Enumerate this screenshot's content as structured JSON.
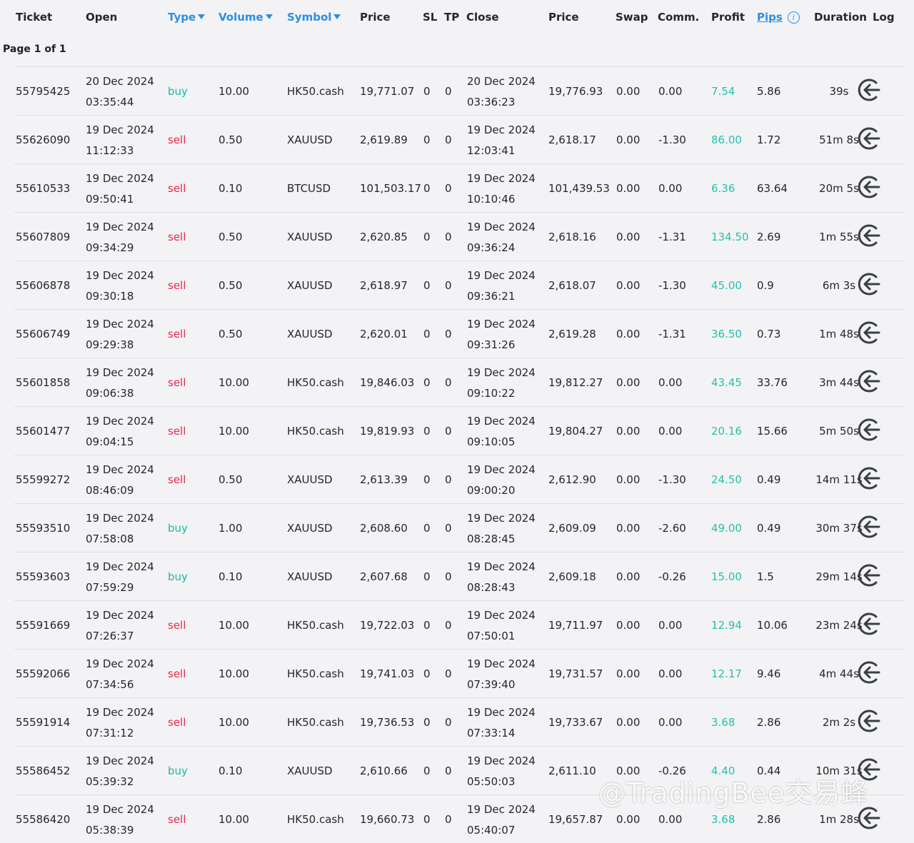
{
  "header": {
    "ticket": "Ticket",
    "open": "Open",
    "type": "Type",
    "volume": "Volume",
    "symbol": "Symbol",
    "price": "Price",
    "sl": "SL",
    "tp": "TP",
    "close": "Close",
    "close_price": "Price",
    "swap": "Swap",
    "comm": "Comm.",
    "profit": "Profit",
    "pips": "Pips",
    "info": "i",
    "duration": "Duration",
    "log": "Log"
  },
  "page_info": "Page 1 of 1",
  "colors": {
    "buy": "#1bb8a8",
    "sell": "#e8274b",
    "profit": "#25c1ad",
    "link": "#2d8ee3"
  },
  "rows": [
    {
      "ticket": "55795425",
      "open_date": "20 Dec 2024",
      "open_time": "03:35:44",
      "type": "buy",
      "volume": "10.00",
      "symbol": "HK50.cash",
      "price": "19,771.07",
      "sl": "0",
      "tp": "0",
      "close_date": "20 Dec 2024",
      "close_time": "03:36:23",
      "close_price": "19,776.93",
      "swap": "0.00",
      "comm": "0.00",
      "profit": "7.54",
      "pips": "5.86",
      "duration": "39s"
    },
    {
      "ticket": "55626090",
      "open_date": "19 Dec 2024",
      "open_time": "11:12:33",
      "type": "sell",
      "volume": "0.50",
      "symbol": "XAUUSD",
      "price": "2,619.89",
      "sl": "0",
      "tp": "0",
      "close_date": "19 Dec 2024",
      "close_time": "12:03:41",
      "close_price": "2,618.17",
      "swap": "0.00",
      "comm": "-1.30",
      "profit": "86.00",
      "pips": "1.72",
      "duration": "51m 8s"
    },
    {
      "ticket": "55610533",
      "open_date": "19 Dec 2024",
      "open_time": "09:50:41",
      "type": "sell",
      "volume": "0.10",
      "symbol": "BTCUSD",
      "price": "101,503.17",
      "sl": "0",
      "tp": "0",
      "close_date": "19 Dec 2024",
      "close_time": "10:10:46",
      "close_price": "101,439.53",
      "swap": "0.00",
      "comm": "0.00",
      "profit": "6.36",
      "pips": "63.64",
      "duration": "20m 5s"
    },
    {
      "ticket": "55607809",
      "open_date": "19 Dec 2024",
      "open_time": "09:34:29",
      "type": "sell",
      "volume": "0.50",
      "symbol": "XAUUSD",
      "price": "2,620.85",
      "sl": "0",
      "tp": "0",
      "close_date": "19 Dec 2024",
      "close_time": "09:36:24",
      "close_price": "2,618.16",
      "swap": "0.00",
      "comm": "-1.31",
      "profit": "134.50",
      "pips": "2.69",
      "duration": "1m 55s"
    },
    {
      "ticket": "55606878",
      "open_date": "19 Dec 2024",
      "open_time": "09:30:18",
      "type": "sell",
      "volume": "0.50",
      "symbol": "XAUUSD",
      "price": "2,618.97",
      "sl": "0",
      "tp": "0",
      "close_date": "19 Dec 2024",
      "close_time": "09:36:21",
      "close_price": "2,618.07",
      "swap": "0.00",
      "comm": "-1.30",
      "profit": "45.00",
      "pips": "0.9",
      "duration": "6m 3s"
    },
    {
      "ticket": "55606749",
      "open_date": "19 Dec 2024",
      "open_time": "09:29:38",
      "type": "sell",
      "volume": "0.50",
      "symbol": "XAUUSD",
      "price": "2,620.01",
      "sl": "0",
      "tp": "0",
      "close_date": "19 Dec 2024",
      "close_time": "09:31:26",
      "close_price": "2,619.28",
      "swap": "0.00",
      "comm": "-1.31",
      "profit": "36.50",
      "pips": "0.73",
      "duration": "1m 48s"
    },
    {
      "ticket": "55601858",
      "open_date": "19 Dec 2024",
      "open_time": "09:06:38",
      "type": "sell",
      "volume": "10.00",
      "symbol": "HK50.cash",
      "price": "19,846.03",
      "sl": "0",
      "tp": "0",
      "close_date": "19 Dec 2024",
      "close_time": "09:10:22",
      "close_price": "19,812.27",
      "swap": "0.00",
      "comm": "0.00",
      "profit": "43.45",
      "pips": "33.76",
      "duration": "3m 44s"
    },
    {
      "ticket": "55601477",
      "open_date": "19 Dec 2024",
      "open_time": "09:04:15",
      "type": "sell",
      "volume": "10.00",
      "symbol": "HK50.cash",
      "price": "19,819.93",
      "sl": "0",
      "tp": "0",
      "close_date": "19 Dec 2024",
      "close_time": "09:10:05",
      "close_price": "19,804.27",
      "swap": "0.00",
      "comm": "0.00",
      "profit": "20.16",
      "pips": "15.66",
      "duration": "5m 50s"
    },
    {
      "ticket": "55599272",
      "open_date": "19 Dec 2024",
      "open_time": "08:46:09",
      "type": "sell",
      "volume": "0.50",
      "symbol": "XAUUSD",
      "price": "2,613.39",
      "sl": "0",
      "tp": "0",
      "close_date": "19 Dec 2024",
      "close_time": "09:00:20",
      "close_price": "2,612.90",
      "swap": "0.00",
      "comm": "-1.30",
      "profit": "24.50",
      "pips": "0.49",
      "duration": "14m 11s"
    },
    {
      "ticket": "55593510",
      "open_date": "19 Dec 2024",
      "open_time": "07:58:08",
      "type": "buy",
      "volume": "1.00",
      "symbol": "XAUUSD",
      "price": "2,608.60",
      "sl": "0",
      "tp": "0",
      "close_date": "19 Dec 2024",
      "close_time": "08:28:45",
      "close_price": "2,609.09",
      "swap": "0.00",
      "comm": "-2.60",
      "profit": "49.00",
      "pips": "0.49",
      "duration": "30m 37s"
    },
    {
      "ticket": "55593603",
      "open_date": "19 Dec 2024",
      "open_time": "07:59:29",
      "type": "buy",
      "volume": "0.10",
      "symbol": "XAUUSD",
      "price": "2,607.68",
      "sl": "0",
      "tp": "0",
      "close_date": "19 Dec 2024",
      "close_time": "08:28:43",
      "close_price": "2,609.18",
      "swap": "0.00",
      "comm": "-0.26",
      "profit": "15.00",
      "pips": "1.5",
      "duration": "29m 14s"
    },
    {
      "ticket": "55591669",
      "open_date": "19 Dec 2024",
      "open_time": "07:26:37",
      "type": "sell",
      "volume": "10.00",
      "symbol": "HK50.cash",
      "price": "19,722.03",
      "sl": "0",
      "tp": "0",
      "close_date": "19 Dec 2024",
      "close_time": "07:50:01",
      "close_price": "19,711.97",
      "swap": "0.00",
      "comm": "0.00",
      "profit": "12.94",
      "pips": "10.06",
      "duration": "23m 24s"
    },
    {
      "ticket": "55592066",
      "open_date": "19 Dec 2024",
      "open_time": "07:34:56",
      "type": "sell",
      "volume": "10.00",
      "symbol": "HK50.cash",
      "price": "19,741.03",
      "sl": "0",
      "tp": "0",
      "close_date": "19 Dec 2024",
      "close_time": "07:39:40",
      "close_price": "19,731.57",
      "swap": "0.00",
      "comm": "0.00",
      "profit": "12.17",
      "pips": "9.46",
      "duration": "4m 44s"
    },
    {
      "ticket": "55591914",
      "open_date": "19 Dec 2024",
      "open_time": "07:31:12",
      "type": "sell",
      "volume": "10.00",
      "symbol": "HK50.cash",
      "price": "19,736.53",
      "sl": "0",
      "tp": "0",
      "close_date": "19 Dec 2024",
      "close_time": "07:33:14",
      "close_price": "19,733.67",
      "swap": "0.00",
      "comm": "0.00",
      "profit": "3.68",
      "pips": "2.86",
      "duration": "2m 2s"
    },
    {
      "ticket": "55586452",
      "open_date": "19 Dec 2024",
      "open_time": "05:39:32",
      "type": "buy",
      "volume": "0.10",
      "symbol": "XAUUSD",
      "price": "2,610.66",
      "sl": "0",
      "tp": "0",
      "close_date": "19 Dec 2024",
      "close_time": "05:50:03",
      "close_price": "2,611.10",
      "swap": "0.00",
      "comm": "-0.26",
      "profit": "4.40",
      "pips": "0.44",
      "duration": "10m 31s"
    },
    {
      "ticket": "55586420",
      "open_date": "19 Dec 2024",
      "open_time": "05:38:39",
      "type": "sell",
      "volume": "10.00",
      "symbol": "HK50.cash",
      "price": "19,660.73",
      "sl": "0",
      "tp": "0",
      "close_date": "19 Dec 2024",
      "close_time": "05:40:07",
      "close_price": "19,657.87",
      "swap": "0.00",
      "comm": "0.00",
      "profit": "3.68",
      "pips": "2.86",
      "duration": "1m 28s"
    }
  ],
  "watermark": "@TradingBee交易蜂"
}
